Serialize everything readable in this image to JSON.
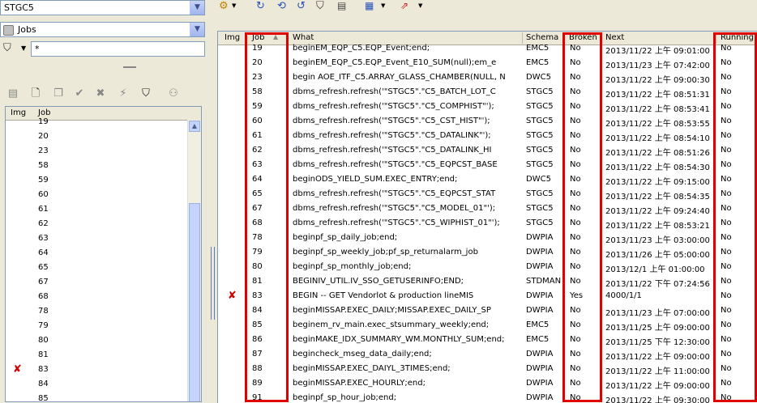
{
  "schema_selector": {
    "value": "STGC5"
  },
  "object_type_selector": {
    "value": "Jobs"
  },
  "filter": {
    "value": "*"
  },
  "left_list": {
    "headers": {
      "img": "Img",
      "job": "Job"
    },
    "rows": [
      {
        "job": "19",
        "broken": false
      },
      {
        "job": "20",
        "broken": false
      },
      {
        "job": "23",
        "broken": false
      },
      {
        "job": "58",
        "broken": false
      },
      {
        "job": "59",
        "broken": false
      },
      {
        "job": "60",
        "broken": false
      },
      {
        "job": "61",
        "broken": false
      },
      {
        "job": "62",
        "broken": false
      },
      {
        "job": "63",
        "broken": false
      },
      {
        "job": "64",
        "broken": false
      },
      {
        "job": "65",
        "broken": false
      },
      {
        "job": "67",
        "broken": false
      },
      {
        "job": "68",
        "broken": false
      },
      {
        "job": "78",
        "broken": false
      },
      {
        "job": "79",
        "broken": false
      },
      {
        "job": "80",
        "broken": false
      },
      {
        "job": "81",
        "broken": false
      },
      {
        "job": "83",
        "broken": true
      },
      {
        "job": "84",
        "broken": false
      },
      {
        "job": "85",
        "broken": false
      }
    ]
  },
  "grid": {
    "headers": {
      "img": "Img",
      "job": "Job",
      "what": "What",
      "schema": "Schema",
      "broken": "Broken",
      "next": "Next",
      "running": "Running"
    },
    "rows": [
      {
        "job": "19",
        "what": "beginEM_EQP_C5.EQP_Event;end;",
        "schema": "EMC5",
        "broken": "No",
        "next": "2013/11/22 上午 09:01:00",
        "running": "No",
        "x": false
      },
      {
        "job": "20",
        "what": "beginEM_EQP_C5.EQP_Event_E10_SUM(null);em_e",
        "schema": "EMC5",
        "broken": "No",
        "next": "2013/11/23 上午 07:42:00",
        "running": "No",
        "x": false
      },
      {
        "job": "23",
        "what": "begin AOE_ITF_C5.ARRAY_GLASS_CHAMBER(NULL, N",
        "schema": "DWC5",
        "broken": "No",
        "next": "2013/11/22 上午 09:00:30",
        "running": "No",
        "x": false
      },
      {
        "job": "58",
        "what": "dbms_refresh.refresh('\"STGC5\".\"C5_BATCH_LOT_C",
        "schema": "STGC5",
        "broken": "No",
        "next": "2013/11/22 上午 08:51:31",
        "running": "No",
        "x": false
      },
      {
        "job": "59",
        "what": "dbms_refresh.refresh('\"STGC5\".\"C5_COMPHIST\"');",
        "schema": "STGC5",
        "broken": "No",
        "next": "2013/11/22 上午 08:53:41",
        "running": "No",
        "x": false
      },
      {
        "job": "60",
        "what": "dbms_refresh.refresh('\"STGC5\".\"C5_CST_HIST\"');",
        "schema": "STGC5",
        "broken": "No",
        "next": "2013/11/22 上午 08:53:55",
        "running": "No",
        "x": false
      },
      {
        "job": "61",
        "what": "dbms_refresh.refresh('\"STGC5\".\"C5_DATALINK\"');",
        "schema": "STGC5",
        "broken": "No",
        "next": "2013/11/22 上午 08:54:10",
        "running": "No",
        "x": false
      },
      {
        "job": "62",
        "what": "dbms_refresh.refresh('\"STGC5\".\"C5_DATALINK_HI",
        "schema": "STGC5",
        "broken": "No",
        "next": "2013/11/22 上午 08:51:26",
        "running": "No",
        "x": false
      },
      {
        "job": "63",
        "what": "dbms_refresh.refresh('\"STGC5\".\"C5_EQPCST_BASE",
        "schema": "STGC5",
        "broken": "No",
        "next": "2013/11/22 上午 08:54:30",
        "running": "No",
        "x": false
      },
      {
        "job": "64",
        "what": "beginODS_YIELD_SUM.EXEC_ENTRY;end;",
        "schema": "DWC5",
        "broken": "No",
        "next": "2013/11/22 上午 09:15:00",
        "running": "No",
        "x": false
      },
      {
        "job": "65",
        "what": "dbms_refresh.refresh('\"STGC5\".\"C5_EQPCST_STAT",
        "schema": "STGC5",
        "broken": "No",
        "next": "2013/11/22 上午 08:54:35",
        "running": "No",
        "x": false
      },
      {
        "job": "67",
        "what": "dbms_refresh.refresh('\"STGC5\".\"C5_MODEL_01\"');",
        "schema": "STGC5",
        "broken": "No",
        "next": "2013/11/22 上午 09:24:40",
        "running": "No",
        "x": false
      },
      {
        "job": "68",
        "what": "dbms_refresh.refresh('\"STGC5\".\"C5_WIPHIST_01\"');",
        "schema": "STGC5",
        "broken": "No",
        "next": "2013/11/22 上午 08:53:21",
        "running": "No",
        "x": false
      },
      {
        "job": "78",
        "what": "beginpf_sp_daily_job;end;",
        "schema": "DWPIA",
        "broken": "No",
        "next": "2013/11/23 上午 03:00:00",
        "running": "No",
        "x": false
      },
      {
        "job": "79",
        "what": "beginpf_sp_weekly_job;pf_sp_returnalarm_job",
        "schema": "DWPIA",
        "broken": "No",
        "next": "2013/11/26 上午 05:00:00",
        "running": "No",
        "x": false
      },
      {
        "job": "80",
        "what": "beginpf_sp_monthly_job;end;",
        "schema": "DWPIA",
        "broken": "No",
        "next": "2013/12/1 上午 01:00:00",
        "running": "No",
        "x": false
      },
      {
        "job": "81",
        "what": "BEGINIV_UTIL.IV_SSO_GETUSERINFO;END;",
        "schema": "STDMAN",
        "broken": "No",
        "next": "2013/11/22 下午 07:24:56",
        "running": "No",
        "x": false
      },
      {
        "job": "83",
        "what": "BEGIN -- GET Vendorlot & production lineMIS",
        "schema": "DWPIA",
        "broken": "Yes",
        "next": "4000/1/1",
        "running": "No",
        "x": true
      },
      {
        "job": "84",
        "what": "beginMISSAP.EXEC_DAILY;MISSAP.EXEC_DAILY_SP",
        "schema": "DWPIA",
        "broken": "No",
        "next": "2013/11/23 上午 07:00:00",
        "running": "No",
        "x": false
      },
      {
        "job": "85",
        "what": "beginem_rv_main.exec_stsummary_weekly;end;",
        "schema": "EMC5",
        "broken": "No",
        "next": "2013/11/25 上午 09:00:00",
        "running": "No",
        "x": false
      },
      {
        "job": "86",
        "what": "beginMAKE_IDX_SUMMARY_WM.MONTHLY_SUM;end;",
        "schema": "EMC5",
        "broken": "No",
        "next": "2013/11/25 下午 12:30:00",
        "running": "No",
        "x": false
      },
      {
        "job": "87",
        "what": "begincheck_mseg_data_daily;end;",
        "schema": "DWPIA",
        "broken": "No",
        "next": "2013/11/22 上午 09:00:00",
        "running": "No",
        "x": false
      },
      {
        "job": "88",
        "what": "beginMISSAP.EXEC_DAIYL_3TIMES;end;",
        "schema": "DWPIA",
        "broken": "No",
        "next": "2013/11/22 上午 11:00:00",
        "running": "No",
        "x": false
      },
      {
        "job": "89",
        "what": "beginMISSAP.EXEC_HOURLY;end;",
        "schema": "DWPIA",
        "broken": "No",
        "next": "2013/11/22 上午 09:00:00",
        "running": "No",
        "x": false
      },
      {
        "job": "91",
        "what": "beginpf_sp_hour_job;end;",
        "schema": "DWPIA",
        "broken": "No",
        "next": "2013/11/22 上午 09:30:00",
        "running": "No",
        "x": false
      }
    ]
  },
  "colors": {
    "highlight": "#e00000",
    "broken_mark": "#d00000"
  }
}
